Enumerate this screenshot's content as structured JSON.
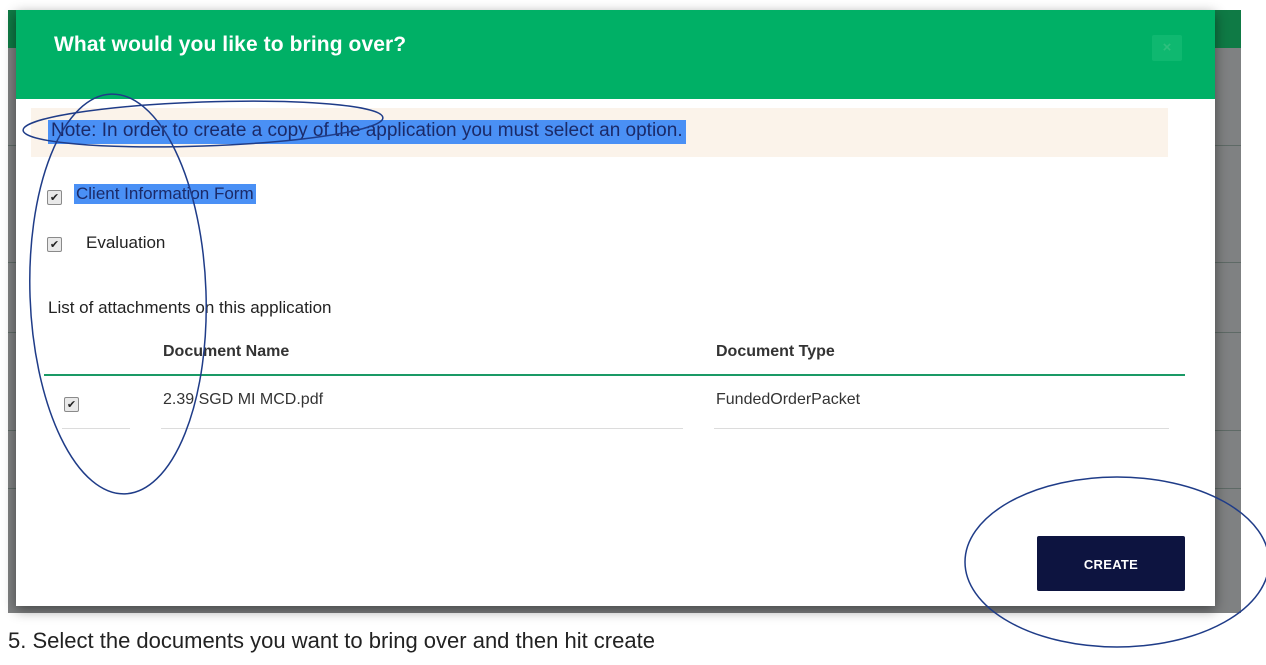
{
  "modal": {
    "title": "What would you like to bring over?",
    "close_label": "×",
    "note": "Note: In order to create a copy of the application you must select an option.",
    "options": [
      {
        "label": "Client Information Form",
        "checked": true
      },
      {
        "label": "Evaluation",
        "checked": true
      }
    ],
    "attachments_label": "List of attachments on this application",
    "table": {
      "headers": [
        "Document Name",
        "Document Type"
      ],
      "rows": [
        {
          "checked": true,
          "document_name": "2.39 SGD MI MCD.pdf",
          "document_type": "FundedOrderPacket"
        }
      ]
    },
    "create_label": "CREATE"
  },
  "caption": "5. Select the documents you want to bring over and then hit create",
  "colors": {
    "header_green": "#00b066",
    "button_navy": "#0d1440",
    "annotation_blue": "#1f3c88",
    "selection_blue": "#4a90f5"
  }
}
